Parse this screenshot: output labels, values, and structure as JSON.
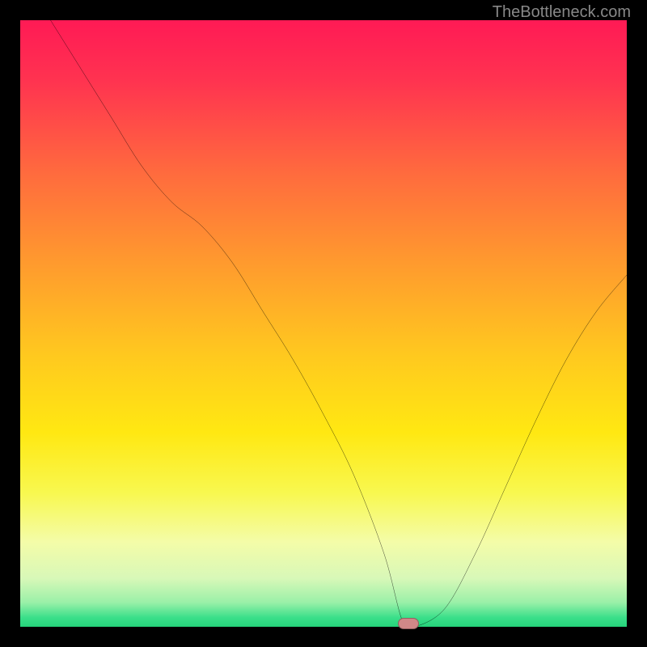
{
  "watermark": "TheBottleneck.com",
  "chart_data": {
    "type": "line",
    "title": "",
    "xlabel": "",
    "ylabel": "",
    "xlim": [
      0,
      100
    ],
    "ylim": [
      0,
      100
    ],
    "x": [
      5,
      10,
      15,
      20,
      25,
      30,
      35,
      40,
      45,
      50,
      55,
      60,
      63,
      65,
      70,
      75,
      80,
      85,
      90,
      95,
      100
    ],
    "values": [
      100,
      92,
      84,
      76,
      70,
      66,
      60,
      52,
      44,
      35,
      25,
      12,
      1,
      0,
      3,
      12,
      23,
      34,
      44,
      52,
      58
    ],
    "marker": {
      "x": 64,
      "y": 0.5
    },
    "gradient_stops": [
      {
        "offset": 0.0,
        "color": "#ff1a55"
      },
      {
        "offset": 0.1,
        "color": "#ff3350"
      },
      {
        "offset": 0.25,
        "color": "#ff6a3e"
      },
      {
        "offset": 0.4,
        "color": "#ff9a2e"
      },
      {
        "offset": 0.55,
        "color": "#ffc81f"
      },
      {
        "offset": 0.68,
        "color": "#ffe812"
      },
      {
        "offset": 0.78,
        "color": "#f8f850"
      },
      {
        "offset": 0.86,
        "color": "#f4fca8"
      },
      {
        "offset": 0.92,
        "color": "#d8f8b8"
      },
      {
        "offset": 0.96,
        "color": "#9af0a8"
      },
      {
        "offset": 0.985,
        "color": "#3adf8a"
      },
      {
        "offset": 1.0,
        "color": "#25d37a"
      }
    ]
  }
}
